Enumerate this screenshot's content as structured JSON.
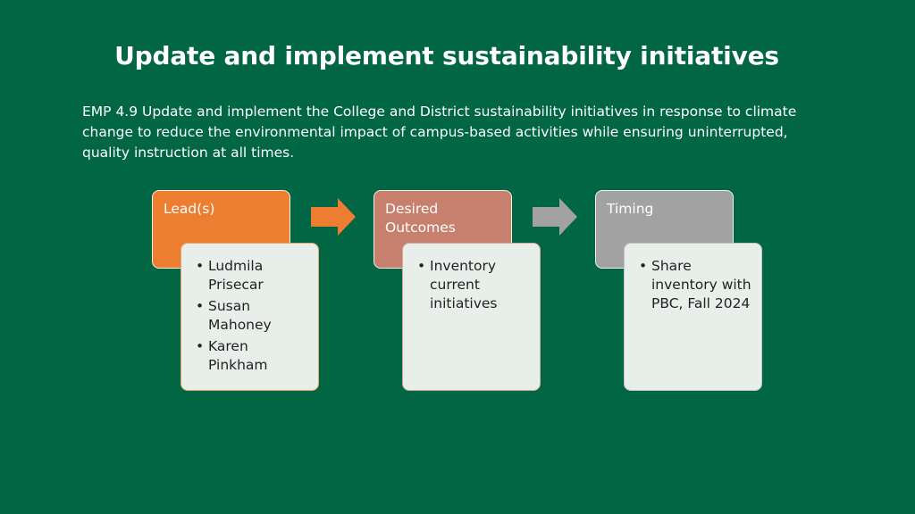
{
  "title": "Update and implement sustainability initiatives",
  "description": "EMP 4.9 Update and implement the College and District sustainability initiatives in response to climate change to reduce the environmental impact of campus-based activities while ensuring uninterrupted, quality instruction at all times.",
  "colors": {
    "background": "#006644",
    "lead": "#ed7d31",
    "outcomes": "#c8806e",
    "timing": "#a2a2a2",
    "content_bg": "#e8efea",
    "arrow_orange": "#ed7d31",
    "arrow_gray": "#a2a2a2"
  },
  "columns": [
    {
      "header": "Lead(s)",
      "items": [
        "Ludmila Prisecar",
        "Susan Mahoney",
        "Karen Pinkham"
      ]
    },
    {
      "header": "Desired Outcomes",
      "items": [
        "Inventory current initiatives"
      ]
    },
    {
      "header": "Timing",
      "items": [
        "Share inventory with PBC, Fall 2024"
      ]
    }
  ],
  "arrows": [
    "arrow-right-icon",
    "arrow-right-icon"
  ]
}
